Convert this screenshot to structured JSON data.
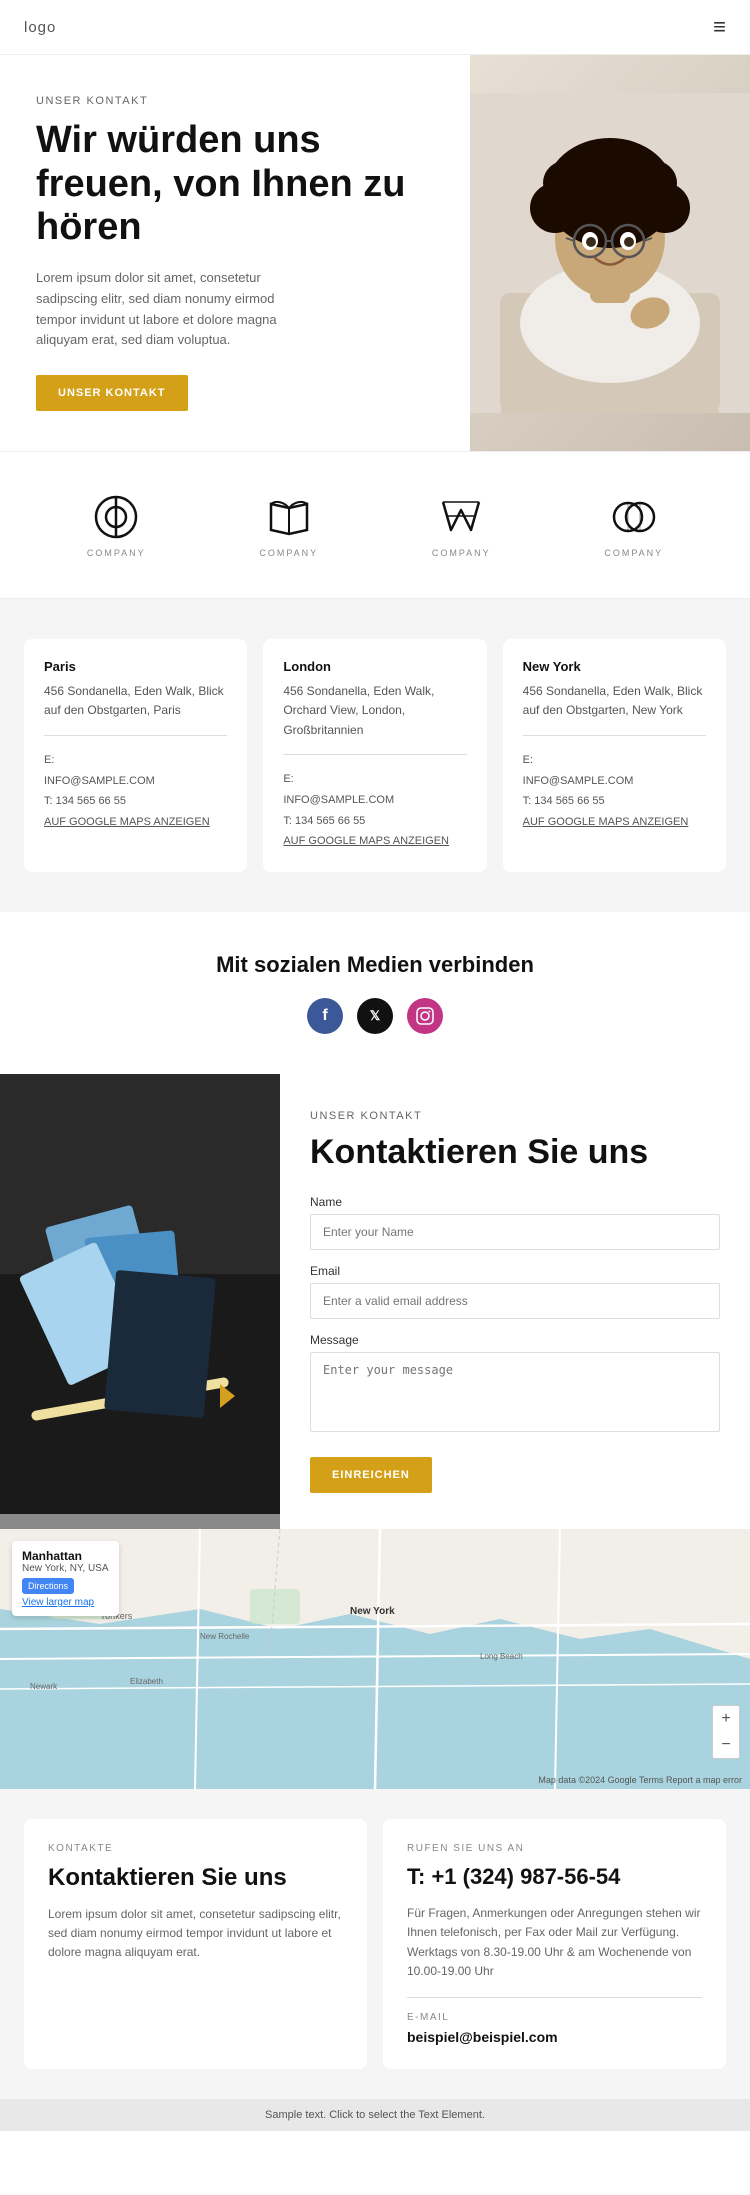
{
  "header": {
    "logo": "logo",
    "menu_icon": "≡"
  },
  "hero": {
    "label": "UNSER KONTAKT",
    "title": "Wir würden uns freuen, von Ihnen zu hören",
    "description": "Lorem ipsum dolor sit amet, consetetur sadipscing elitr, sed diam nonumy eirmod tempor invidunt ut labore et dolore magna aliquyam erat, sed diam voluptua.",
    "button": "UNSER KONTAKT"
  },
  "partners": [
    {
      "name": "COMPANY"
    },
    {
      "name": "COMPANY"
    },
    {
      "name": "COMPANY"
    },
    {
      "name": "COMPANY"
    }
  ],
  "locations": [
    {
      "city": "Paris",
      "address": "456 Sondanella, Eden Walk, Blick auf den Obstgarten, Paris",
      "email_label": "E:",
      "email": "INFO@SAMPLE.COM",
      "phone_label": "T:",
      "phone": "134 565 66 55",
      "maps_link": "AUF GOOGLE MAPS ANZEIGEN"
    },
    {
      "city": "London",
      "address": "456 Sondanella, Eden Walk, Orchard View, London, Großbritannien",
      "email_label": "E:",
      "email": "INFO@SAMPLE.COM",
      "phone_label": "T:",
      "phone": "134 565 66 55",
      "maps_link": "AUF GOOGLE MAPS ANZEIGEN"
    },
    {
      "city": "New York",
      "address": "456 Sondanella, Eden Walk, Blick auf den Obstgarten, New York",
      "email_label": "E:",
      "email": "INFO@SAMPLE.COM",
      "phone_label": "T:",
      "phone": "134 565 66 55",
      "maps_link": "AUF GOOGLE MAPS ANZEIGEN"
    }
  ],
  "social": {
    "title": "Mit sozialen Medien verbinden",
    "icons": [
      "f",
      "𝕏",
      "◉"
    ]
  },
  "contact_form": {
    "label": "UNSER KONTAKT",
    "title": "Kontaktieren Sie uns",
    "fields": {
      "name_label": "Name",
      "name_placeholder": "Enter your Name",
      "email_label": "Email",
      "email_placeholder": "Enter a valid email address",
      "message_label": "Message",
      "message_placeholder": "Enter your message"
    },
    "submit_button": "EINREICHEN"
  },
  "map": {
    "title": "Manhattan",
    "subtitle": "New York, NY, USA",
    "directions": "Directions",
    "view_larger": "View larger map",
    "zoom_in": "+",
    "zoom_out": "−",
    "copyright": "Map data ©2024 Google  Terms  Report a map error"
  },
  "bottom_cards": {
    "contacts": {
      "label": "KONTAKTE",
      "title": "Kontaktieren Sie uns",
      "description": "Lorem ipsum dolor sit amet, consetetur sadipscing elitr, sed diam nonumy eirmod tempor invidunt ut labore et dolore magna aliquyam erat."
    },
    "call": {
      "label": "RUFEN SIE UNS AN",
      "phone": "T: +1 (324) 987-56-54",
      "description": "Für Fragen, Anmerkungen oder Anregungen stehen wir Ihnen telefonisch, per Fax oder Mail zur Verfügung. Werktags von 8.30-19.00 Uhr & am Wochenende von 10.00-19.00 Uhr",
      "email_label": "E-MAIL",
      "email": "beispiel@beispiel.com"
    }
  },
  "sample_bar": "Sample text. Click to select the Text Element."
}
